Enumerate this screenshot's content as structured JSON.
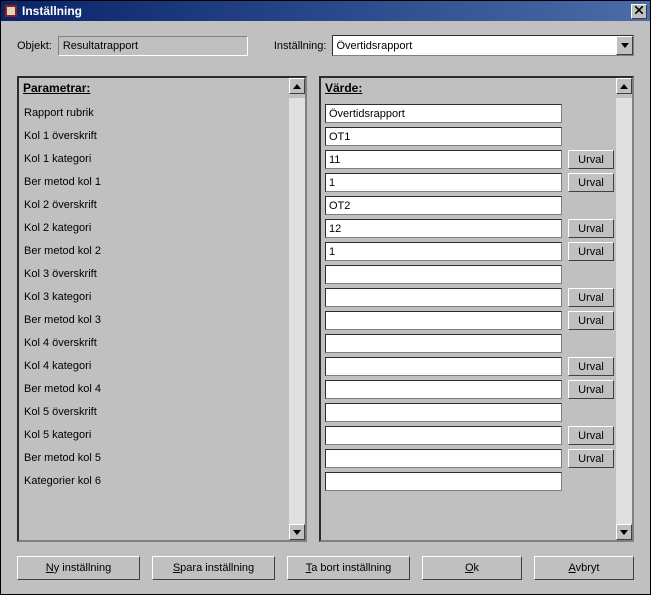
{
  "window": {
    "title": "Inställning"
  },
  "top": {
    "objekt_label": "Objekt:",
    "objekt_value": "Resultatrapport",
    "installning_label": "Inställning:",
    "installning_value": "Övertidsrapport"
  },
  "left": {
    "header": "Parametrar:",
    "params": [
      "Rapport rubrik",
      "Kol 1 överskrift",
      "Kol 1 kategori",
      "Ber metod kol 1",
      "Kol 2 överskrift",
      "Kol 2 kategori",
      "Ber metod kol 2",
      "Kol 3 överskrift",
      "Kol 3 kategori",
      "Ber metod kol 3",
      "Kol 4 överskrift",
      "Kol 4 kategori",
      "Ber metod kol 4",
      "Kol 5 överskrift",
      "Kol 5 kategori",
      "Ber metod kol 5",
      "Kategorier kol 6"
    ]
  },
  "right": {
    "header": "Värde:",
    "rows": [
      {
        "value": "Övertidsrapport",
        "urval": false
      },
      {
        "value": "OT1",
        "urval": false
      },
      {
        "value": "11",
        "urval": true
      },
      {
        "value": "1",
        "urval": true
      },
      {
        "value": "OT2",
        "urval": false
      },
      {
        "value": "12",
        "urval": true
      },
      {
        "value": "1",
        "urval": true
      },
      {
        "value": "",
        "urval": false
      },
      {
        "value": "",
        "urval": true
      },
      {
        "value": "",
        "urval": true
      },
      {
        "value": "",
        "urval": false
      },
      {
        "value": "",
        "urval": true
      },
      {
        "value": "",
        "urval": true
      },
      {
        "value": "",
        "urval": false
      },
      {
        "value": "",
        "urval": true
      },
      {
        "value": "",
        "urval": true
      },
      {
        "value": "",
        "urval": false
      }
    ],
    "urval_label": "Urval"
  },
  "buttons": {
    "ny": "Ny inställning",
    "spara": "Spara inställning",
    "tabort": "Ta bort inställning",
    "ok": "Ok",
    "avbryt": "Avbryt",
    "mnemonics": {
      "ny": "N",
      "spara": "S",
      "tabort": "T",
      "ok": "O",
      "avbryt": "A"
    }
  }
}
